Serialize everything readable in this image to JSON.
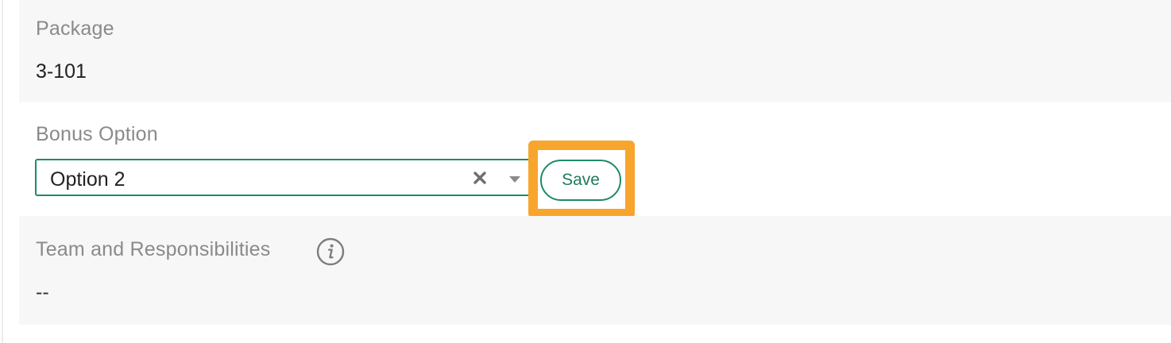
{
  "package": {
    "label": "Package",
    "value": "3-101"
  },
  "bonus_option": {
    "label": "Bonus Option",
    "selected_value": "Option 2",
    "clear_icon": "close-icon",
    "dropdown_icon": "caret-down-icon",
    "save_label": "Save"
  },
  "team_responsibilities": {
    "label": "Team and Responsibilities",
    "info_icon": "info-icon",
    "value": "--"
  },
  "colors": {
    "accent_green": "#1f8a6a",
    "highlight_orange": "#f7a52d",
    "row_gray": "#f7f7f7",
    "label_gray": "#8a8a8a"
  }
}
